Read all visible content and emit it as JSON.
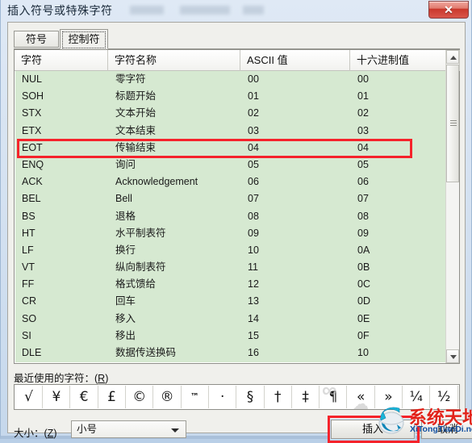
{
  "window": {
    "title": "插入符号或特殊字符",
    "close_label": "✕"
  },
  "tabs": [
    {
      "label": "符号",
      "active": false
    },
    {
      "label": "控制符",
      "active": true
    }
  ],
  "table": {
    "columns": [
      "字符",
      "字符名称",
      "ASCII 值",
      "十六进制值"
    ],
    "rows": [
      {
        "char": "NUL",
        "name": "零字符",
        "ascii": "00",
        "hex": "00"
      },
      {
        "char": "SOH",
        "name": "标题开始",
        "ascii": "01",
        "hex": "01"
      },
      {
        "char": "STX",
        "name": "文本开始",
        "ascii": "02",
        "hex": "02"
      },
      {
        "char": "ETX",
        "name": "文本结束",
        "ascii": "03",
        "hex": "03"
      },
      {
        "char": "EOT",
        "name": "传输结束",
        "ascii": "04",
        "hex": "04"
      },
      {
        "char": "ENQ",
        "name": "询问",
        "ascii": "05",
        "hex": "05"
      },
      {
        "char": "ACK",
        "name": "Acknowledgement",
        "ascii": "06",
        "hex": "06"
      },
      {
        "char": "BEL",
        "name": "Bell",
        "ascii": "07",
        "hex": "07"
      },
      {
        "char": "BS",
        "name": "退格",
        "ascii": "08",
        "hex": "08"
      },
      {
        "char": "HT",
        "name": "水平制表符",
        "ascii": "09",
        "hex": "09"
      },
      {
        "char": "LF",
        "name": "换行",
        "ascii": "10",
        "hex": "0A"
      },
      {
        "char": "VT",
        "name": "纵向制表符",
        "ascii": "11",
        "hex": "0B"
      },
      {
        "char": "FF",
        "name": "格式馈给",
        "ascii": "12",
        "hex": "0C"
      },
      {
        "char": "CR",
        "name": "回车",
        "ascii": "13",
        "hex": "0D"
      },
      {
        "char": "SO",
        "name": "移入",
        "ascii": "14",
        "hex": "0E"
      },
      {
        "char": "SI",
        "name": "移出",
        "ascii": "15",
        "hex": "0F"
      },
      {
        "char": "DLE",
        "name": "数据传送换码",
        "ascii": "16",
        "hex": "10"
      }
    ],
    "highlighted_row_char": "EOT"
  },
  "recent": {
    "label_text": "最近使用的字符：(",
    "label_key": "R",
    "label_tail": ")",
    "symbols": [
      "√",
      "¥",
      "€",
      "£",
      "©",
      "®",
      "™",
      "·",
      "§",
      "†",
      "‡",
      "¶",
      "«",
      "»",
      "¼",
      "½"
    ]
  },
  "footer": {
    "size_label_text": "大小：(",
    "size_label_key": "Z",
    "size_label_tail": ")",
    "size_value": "小号",
    "insert_label": "插入",
    "cancel_label": "取消"
  },
  "watermark": {
    "cn": "系统天地",
    "en": "XiTongTianDi.net"
  },
  "colors": {
    "list_background": "#d6e9d1",
    "annotation_red": "#f5232b",
    "watermark_red": "#e2231a",
    "watermark_blue": "#1450a0"
  }
}
